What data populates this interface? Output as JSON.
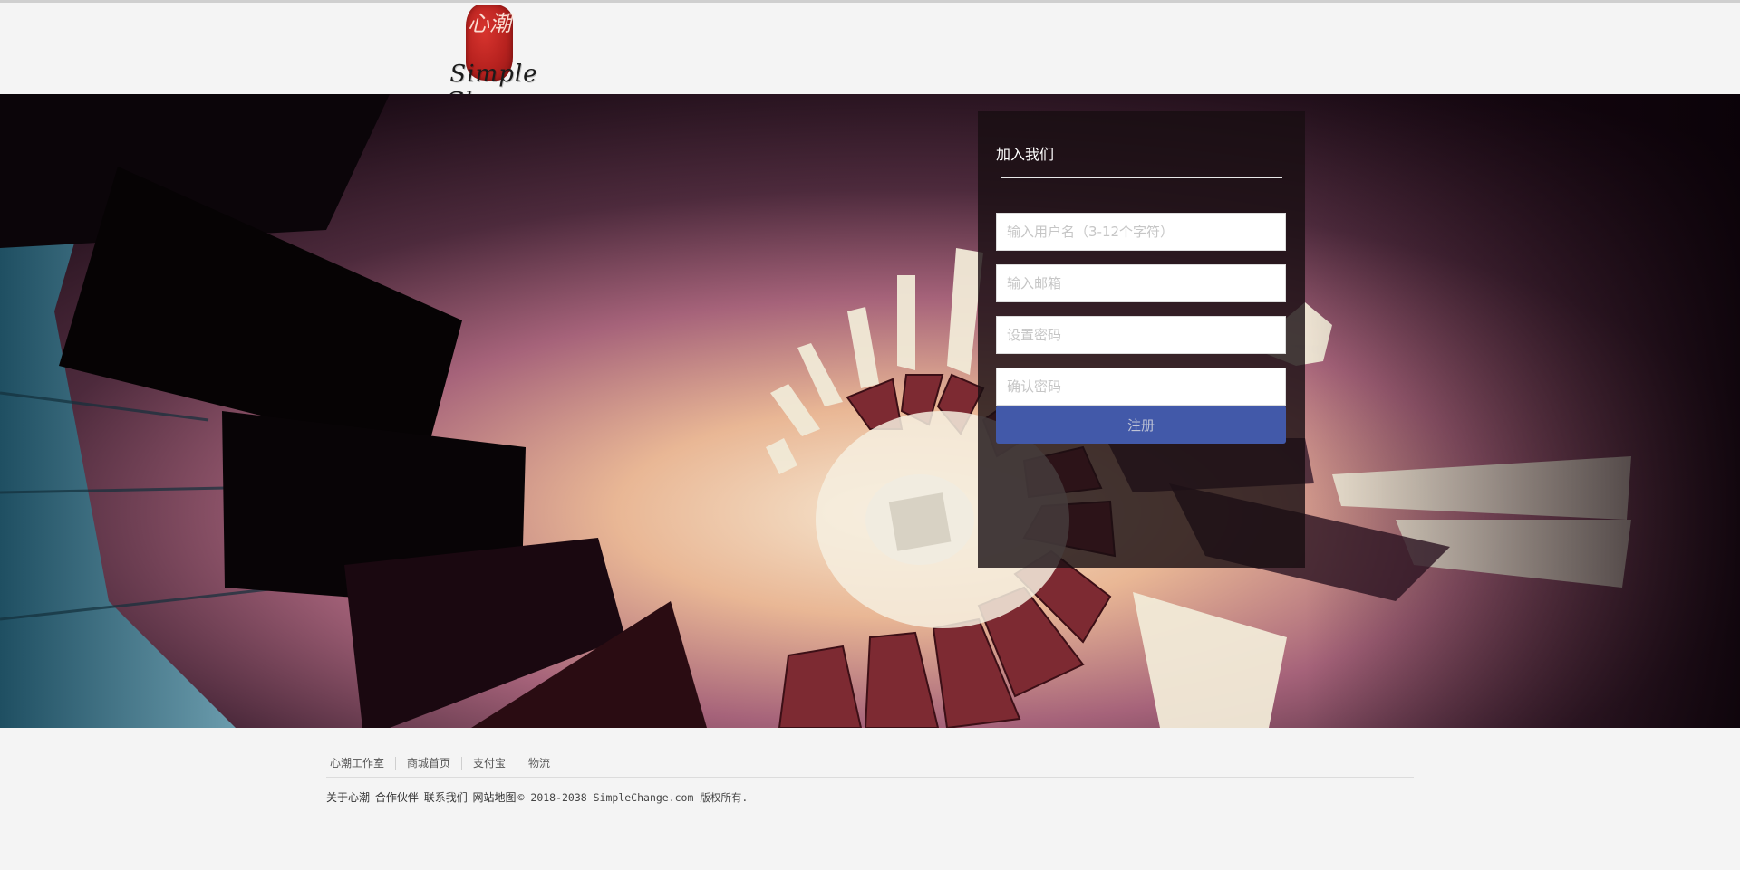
{
  "logo": {
    "seal_text": "心潮",
    "script_text": "Simple Change"
  },
  "signup": {
    "title": "加入我们",
    "username_placeholder": "输入用户名（3-12个字符）",
    "email_placeholder": "输入邮箱",
    "password_placeholder": "设置密码",
    "confirm_placeholder": "确认密码",
    "submit_label": "注册",
    "submit_color": "#4259a9"
  },
  "footer": {
    "links": [
      "心潮工作室",
      "商城首页",
      "支付宝",
      "物流"
    ],
    "bottom_links": [
      "关于心潮",
      "合作伙伴",
      "联系我们",
      "网站地图"
    ],
    "copyright": "© 2018-2038 SimpleChange.com 版权所有."
  }
}
